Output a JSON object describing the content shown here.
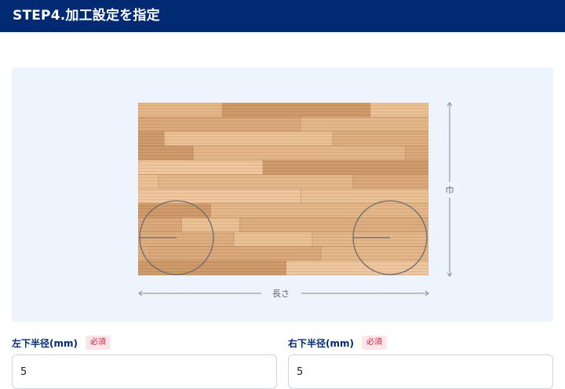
{
  "header": {
    "title": "STEP4.加工設定を指定"
  },
  "diagram": {
    "length_label": "長さ",
    "width_label": "巾"
  },
  "fields": {
    "left": {
      "label": "左下半径(mm)",
      "badge": "必須",
      "value": "5"
    },
    "right": {
      "label": "右下半径(mm)",
      "badge": "必須",
      "value": "5"
    }
  },
  "colors": {
    "header_bg": "#012a72",
    "wood_light": "#e8bd8f",
    "wood_dark": "#cf9a67",
    "badge_text": "#d81b3b"
  }
}
